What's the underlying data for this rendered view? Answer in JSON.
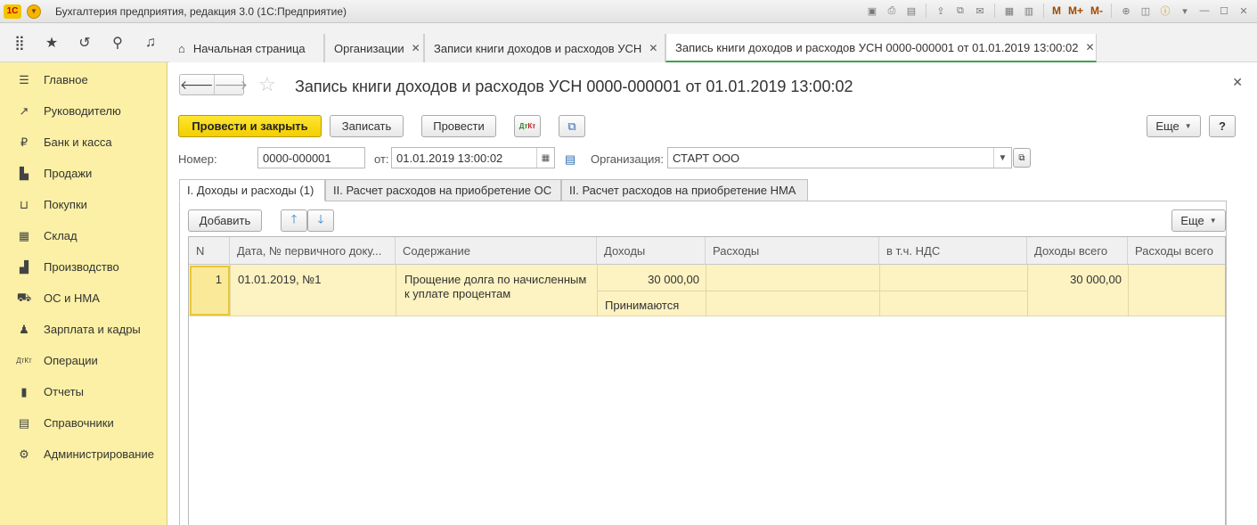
{
  "window": {
    "app_title": "Бухгалтерия предприятия, редакция 3.0  (1С:Предприятие)",
    "logo": "1C",
    "toolbar_m": [
      "M",
      "M+",
      "M-"
    ]
  },
  "nav": {
    "tabs": [
      {
        "label": "Начальная страница"
      },
      {
        "label": "Организации"
      },
      {
        "label": "Записи книги доходов и расходов УСН"
      },
      {
        "label": "Запись книги доходов и расходов УСН 0000-000001 от 01.01.2019 13:00:02"
      }
    ]
  },
  "sidebar": {
    "items": [
      {
        "label": "Главное",
        "icon": "menu-lines-icon"
      },
      {
        "label": "Руководителю",
        "icon": "trend-icon"
      },
      {
        "label": "Банк и касса",
        "icon": "coin-icon"
      },
      {
        "label": "Продажи",
        "icon": "bag-icon"
      },
      {
        "label": "Покупки",
        "icon": "cart-icon"
      },
      {
        "label": "Склад",
        "icon": "warehouse-icon"
      },
      {
        "label": "Производство",
        "icon": "factory-icon"
      },
      {
        "label": "ОС и НМА",
        "icon": "truck-icon"
      },
      {
        "label": "Зарплата и кадры",
        "icon": "person-icon"
      },
      {
        "label": "Операции",
        "icon": "dt-kt-icon"
      },
      {
        "label": "Отчеты",
        "icon": "bar-chart-icon"
      },
      {
        "label": "Справочники",
        "icon": "book-icon"
      },
      {
        "label": "Администрирование",
        "icon": "gear-icon"
      }
    ]
  },
  "document": {
    "title": "Запись книги доходов и расходов УСН 0000-000001 от 01.01.2019 13:00:02",
    "buttons": {
      "post_close": "Провести и закрыть",
      "save": "Записать",
      "post": "Провести",
      "more": "Еще",
      "help": "?"
    },
    "form": {
      "number_label": "Номер:",
      "number_value": "0000-000001",
      "date_label": "от:",
      "date_value": "01.01.2019 13:00:02",
      "org_label": "Организация:",
      "org_value": "СТАРТ ООО"
    },
    "tabs": [
      {
        "label": "I. Доходы и расходы (1)"
      },
      {
        "label": "II. Расчет расходов на приобретение ОС"
      },
      {
        "label": "II. Расчет расходов на приобретение НМА"
      }
    ],
    "table_buttons": {
      "add": "Добавить",
      "more": "Еще"
    },
    "table": {
      "columns": [
        "N",
        "Дата, № первичного доку...",
        "Содержание",
        "Доходы",
        "Расходы",
        "в т.ч. НДС",
        "Доходы всего",
        "Расходы всего"
      ],
      "rows": [
        {
          "n": "1",
          "date_doc": "01.01.2019, №1",
          "content_line1": "Прощение долга по начисленным",
          "content_line2": "к уплате процентам",
          "income": "30 000,00",
          "income_status": "Принимаются",
          "expense": "",
          "vat": "",
          "income_total": "30 000,00",
          "expense_total": ""
        }
      ]
    }
  }
}
